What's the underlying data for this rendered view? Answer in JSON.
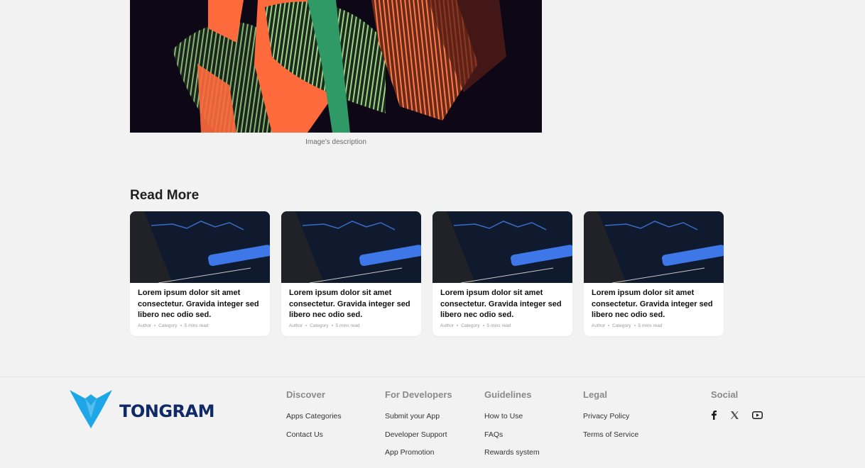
{
  "hero": {
    "caption": "Image's description"
  },
  "read_more": {
    "title": "Read More",
    "cards": [
      {
        "title": "Lorem ipsum dolor sit amet consectetur. Gravida integer sed libero nec odio sed.",
        "author": "Author",
        "category": "Category",
        "read_time": "5 mins read"
      },
      {
        "title": "Lorem ipsum dolor sit amet consectetur. Gravida integer sed libero nec odio sed.",
        "author": "Author",
        "category": "Category",
        "read_time": "5 mins read"
      },
      {
        "title": "Lorem ipsum dolor sit amet consectetur. Gravida integer sed libero nec odio sed.",
        "author": "Author",
        "category": "Category",
        "read_time": "5 mins read"
      },
      {
        "title": "Lorem ipsum dolor sit amet consectetur. Gravida integer sed libero nec odio sed.",
        "author": "Author",
        "category": "Category",
        "read_time": "5 mins read"
      }
    ]
  },
  "footer": {
    "logo_text": "TONGRAM",
    "brand_color": "#1ea7e8",
    "columns": {
      "discover": {
        "heading": "Discover",
        "links": [
          "Apps Categories",
          "Contact Us"
        ]
      },
      "developers": {
        "heading": "For Developers",
        "links": [
          "Submit your App",
          "Developer Support",
          "App Promotion"
        ]
      },
      "guidelines": {
        "heading": "Guidelines",
        "links": [
          "How to Use",
          "FAQs",
          "Rewards system"
        ]
      },
      "legal": {
        "heading": "Legal",
        "links": [
          "Privacy Policy",
          "Terms of Service"
        ]
      },
      "social": {
        "heading": "Social",
        "icons": [
          "facebook-icon",
          "x-icon",
          "youtube-icon"
        ]
      }
    }
  }
}
